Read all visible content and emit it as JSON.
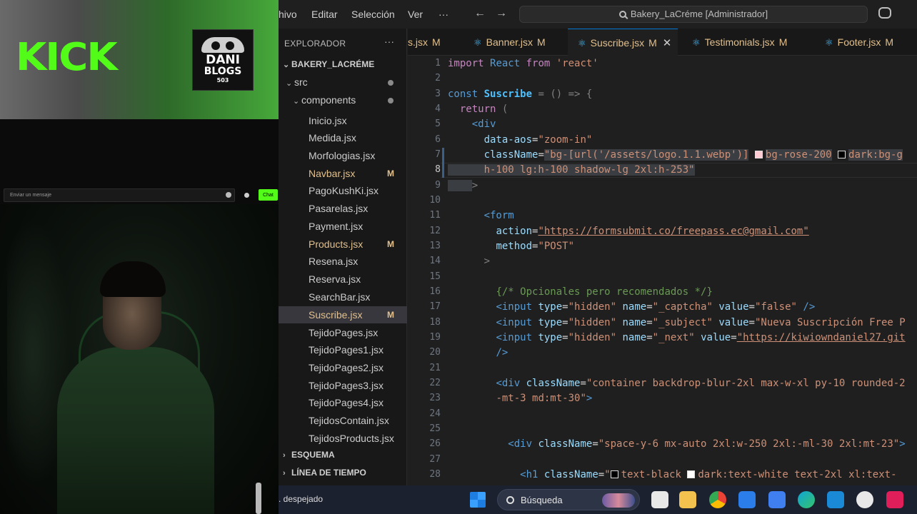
{
  "overlay": {
    "kick_logo": "KICK",
    "channel_logo": {
      "line1": "DANI",
      "line2": "BLOGS",
      "line3": "503"
    },
    "chat": {
      "placeholder": "Enviar un mensaje",
      "send_label": "Chat"
    },
    "colors": {
      "kick_green": "#53fc18"
    }
  },
  "titlebar": {
    "menus": [
      "hivo",
      "Editar",
      "Selección",
      "Ver",
      "···"
    ],
    "search_text": "Bakery_LaCréme [Administrador]"
  },
  "explorer": {
    "title": "EXPLORADOR",
    "project": "BAKERY_LACRÉME",
    "folders": {
      "src": "src",
      "components": "components"
    },
    "files": [
      {
        "name": "Inicio.jsx",
        "status": ""
      },
      {
        "name": "Medida.jsx",
        "status": ""
      },
      {
        "name": "Morfologias.jsx",
        "status": ""
      },
      {
        "name": "Navbar.jsx",
        "status": "M"
      },
      {
        "name": "PagoKushKi.jsx",
        "status": ""
      },
      {
        "name": "Pasarelas.jsx",
        "status": ""
      },
      {
        "name": "Payment.jsx",
        "status": ""
      },
      {
        "name": "Products.jsx",
        "status": "M"
      },
      {
        "name": "Resena.jsx",
        "status": ""
      },
      {
        "name": "Reserva.jsx",
        "status": ""
      },
      {
        "name": "SearchBar.jsx",
        "status": ""
      },
      {
        "name": "Suscribe.jsx",
        "status": "M"
      },
      {
        "name": "TejidoPages.jsx",
        "status": ""
      },
      {
        "name": "TejidoPages1.jsx",
        "status": ""
      },
      {
        "name": "TejidoPages2.jsx",
        "status": ""
      },
      {
        "name": "TejidoPages3.jsx",
        "status": ""
      },
      {
        "name": "TejidoPages4.jsx",
        "status": ""
      },
      {
        "name": "TejidosContain.jsx",
        "status": ""
      },
      {
        "name": "TejidosProducts.jsx",
        "status": ""
      }
    ],
    "sections": [
      "ESQUEMA",
      "LÍNEA DE TIEMPO"
    ]
  },
  "tabs": [
    {
      "name": "s.jsx",
      "status": "M"
    },
    {
      "name": "Banner.jsx",
      "status": "M"
    },
    {
      "name": "Suscribe.jsx",
      "status": "M",
      "active": true
    },
    {
      "name": "Testimonials.jsx",
      "status": "M"
    },
    {
      "name": "Footer.jsx",
      "status": "M"
    }
  ],
  "editor": {
    "current_line": 8,
    "line_numbers": [
      "1",
      "2",
      "3",
      "4",
      "5",
      "6",
      "7",
      "8",
      "9",
      "10",
      "11",
      "12",
      "13",
      "14",
      "15",
      "16",
      "17",
      "18",
      "19",
      "20",
      "21",
      "22",
      "23",
      "24",
      "25",
      "26",
      "27",
      "28"
    ],
    "code": {
      "l1_import": "import",
      "l1_react": "React",
      "l1_from": "from",
      "l1_module": "'react'",
      "l3_const": "const",
      "l3_name": "Suscribe",
      "l3_rest": "= () => {",
      "l4_return": "return",
      "l4_paren": "(",
      "l5_tag": "<div",
      "l6_attr": "data-aos",
      "l6_val": "\"zoom-in\"",
      "l7_attr": "className",
      "l7_val_a": "\"bg-[url('/assets/logo.1.1.webp')]",
      "l7_val_b": "bg-rose-200",
      "l7_val_c": "dark:bg-g",
      "l8_val": "h-100 lg:h-100 shadow-lg 2xl:h-253\"",
      "l9_close": ">",
      "l11_tag": "<form",
      "l12_attr": "action",
      "l12_val": "\"https://formsubmit.co/freepass.ec@gmail.com\"",
      "l13_attr": "method",
      "l13_val": "\"POST\"",
      "l14_close": ">",
      "l16_comment": "{/* Opcionales pero recomendados */}",
      "l17_tag": "<input",
      "l17_a1": "type",
      "l17_v1": "\"hidden\"",
      "l17_a2": "name",
      "l17_v2": "\"_captcha\"",
      "l17_a3": "value",
      "l17_v3": "\"false\"",
      "l17_end": "/>",
      "l18_v2": "\"_subject\"",
      "l18_v3": "\"Nueva Suscripción Free P",
      "l19_v2": "\"_next\"",
      "l19_v3": "\"https://kiwiowndaniel27.git",
      "l20_end": "/>",
      "l22_tag": "<div",
      "l22_attr": "className",
      "l22_val": "\"container backdrop-blur-2xl max-w-xl py-10 rounded-2",
      "l23_val": "-mt-3 md:mt-30\"",
      "l23_end": ">",
      "l26_tag": "<div",
      "l26_attr": "className",
      "l26_val": "\"space-y-6 mx-auto 2xl:w-250 2xl:-ml-30 2xl:mt-23\"",
      "l26_end": ">",
      "l28_tag": "<h1",
      "l28_attr": "className",
      "l28_val_a": "\"",
      "l28_val_b": "text-black",
      "l28_val_c": "dark:text-white text-2xl xl:text-"
    }
  },
  "taskbar": {
    "weather": ". despejado",
    "search_label": "Búsqueda"
  }
}
